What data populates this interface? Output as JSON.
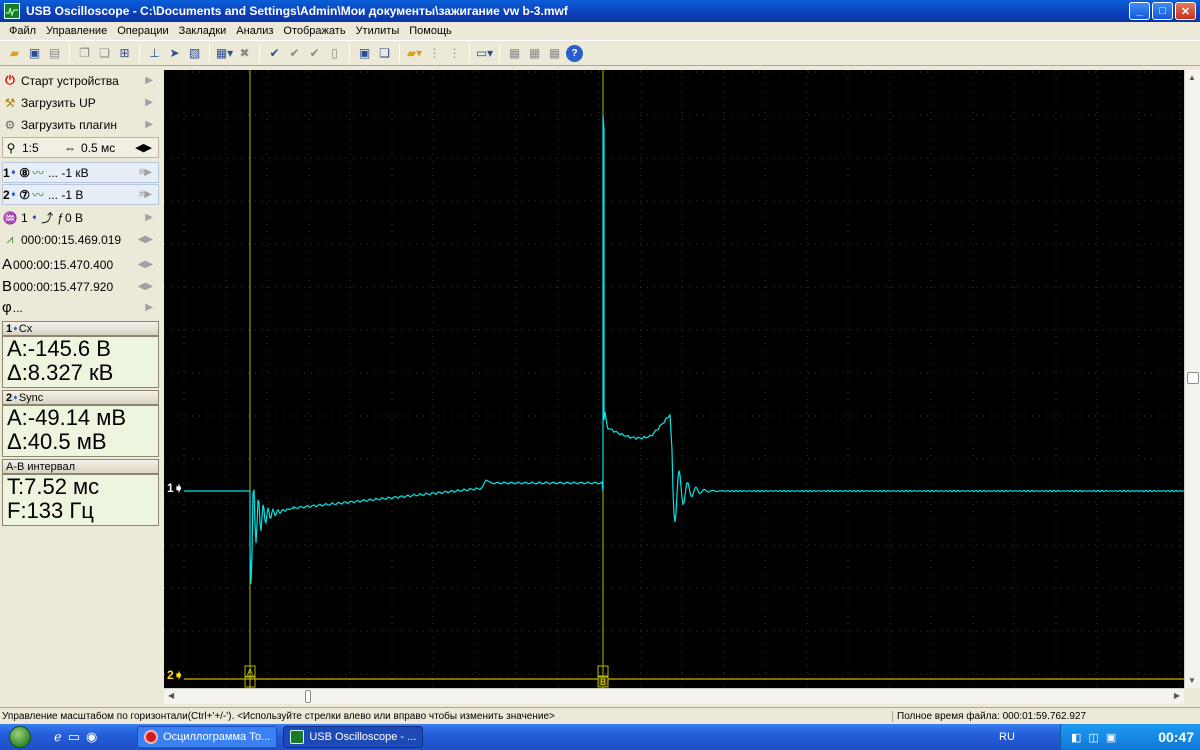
{
  "window": {
    "title": "USB Oscilloscope - C:\\Documents and Settings\\Admin\\Мои документы\\зажигание vw b-3.mwf"
  },
  "menu": [
    "Файл",
    "Управление",
    "Операции",
    "Закладки",
    "Анализ",
    "Отображать",
    "Утилиты",
    "Помощь"
  ],
  "left_panel": {
    "start_device": "Старт устройства",
    "load_up": "Загрузить UP",
    "load_plugin": "Загрузить плагин",
    "zoom": "1:5",
    "timebase": "0.5 мс",
    "ch1": {
      "num": "1",
      "probe": "8",
      "scale": "... -1 кВ"
    },
    "ch2": {
      "num": "2",
      "probe": "7",
      "scale": "... -1 В"
    },
    "trigger": {
      "channel": "1",
      "level": "0 В"
    },
    "trigger_time": "000:00:15.469.019",
    "cursor_a": "000:00:15.470.400",
    "cursor_b": "000:00:15.477.920",
    "phase": "...",
    "meas1": {
      "head": "Cx",
      "a": "А:-145.6 В",
      "d": "Δ:8.327 кВ"
    },
    "meas2": {
      "head": "Sync",
      "a": "А:-49.14 мВ",
      "d": "Δ:40.5 мВ"
    },
    "meas3": {
      "head": "A-B интервал",
      "a": "T:7.52 мс",
      "d": "F:133 Гц"
    }
  },
  "scope": {
    "ch1_marker": "1",
    "ch2_marker": "2",
    "cursor_a_label": "A",
    "cursor_b_label": "B",
    "trace_color": "#00e6e6",
    "ch2_color": "#ffe000",
    "cursor_color": "#b8b800",
    "grid_color": "#3a3a3a"
  },
  "status": {
    "hint": "Управление масштабом по горизонтали(Ctrl+'+/-'). <Используйте стрелки влево или вправо чтобы изменить значение>",
    "file_time": "Полное время файла: 000:01:59.762.927"
  },
  "taskbar": {
    "task1": "Осциллограмма То...",
    "task2": "USB Oscilloscope - ...",
    "lang": "RU",
    "clock": "00:47"
  },
  "icons": {
    "ch1_probe": "circled-8-icon",
    "ch2_probe": "circled-7-icon",
    "start": "power-icon"
  }
}
